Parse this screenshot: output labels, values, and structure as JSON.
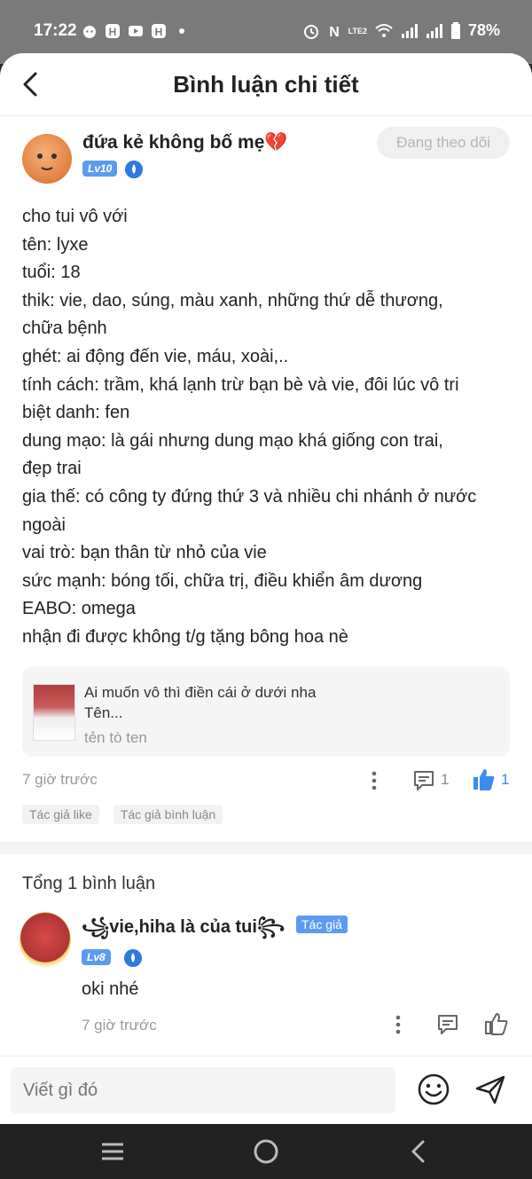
{
  "status_bar": {
    "time": "17:22",
    "battery": "78%",
    "carrier_label": "LTE2"
  },
  "header": {
    "title": "Bình luận chi tiết"
  },
  "post": {
    "author_name": "đứa kẻ không bố mẹ💔",
    "level": "Lv10",
    "follow_label": "Đang theo dõi",
    "body_lines": [
      "cho tui vô với",
      "tên: lyxe",
      "tuổi: 18",
      "thik: vie, dao, súng, màu xanh, những thứ dễ thương,",
      "chữa bệnh",
      "ghét: ai động đến vie, máu, xoài,..",
      "tính cách: trầm, khá lạnh trừ bạn bè và vie, đôi lúc vô tri",
      "biệt danh: fen",
      "dung mạo: là gái nhưng dung mạo khá giống con trai,",
      "đẹp trai",
      "gia thế: có công ty đứng thứ 3 và nhiều chi nhánh ở nước",
      "ngoài",
      "vai trò: bạn thân từ nhỏ của vie",
      "sức mạnh: bóng tối, chữa trị, điều khiển âm dương",
      "EABO: omega",
      "nhận đi được không t/g tặng bông hoa nè"
    ],
    "quote": {
      "line1": "Ai muốn vô thì điền cái ở dưới nha",
      "line2": "Tên...",
      "author": "tẻn tò ten"
    },
    "time": "7 giờ trước",
    "comment_count": "1",
    "like_count": "1",
    "tags": [
      "Tác giả like",
      "Tác giả bình luận"
    ]
  },
  "comments": {
    "heading": "Tổng 1 bình luận",
    "items": [
      {
        "name": "꧁vie,hiha là của tui꧂",
        "author_tag": "Tác giả",
        "level": "Lv8",
        "text": "oki nhé",
        "time": "7 giờ trước"
      }
    ]
  },
  "input": {
    "placeholder": "Viết gì đó"
  },
  "colors": {
    "accent": "#3a8df0",
    "badge": "#5b9cf0"
  }
}
